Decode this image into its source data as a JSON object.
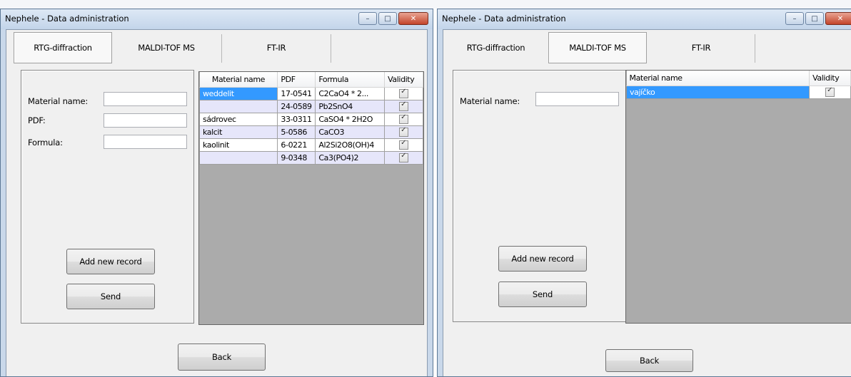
{
  "window1": {
    "title": "Nephele - Data administration",
    "controls": {
      "minimize": "–",
      "maximize": "□",
      "close": "✕"
    },
    "tabs": [
      {
        "label": "RTG-diffraction",
        "active": true
      },
      {
        "label": "MALDI-TOF MS",
        "active": false
      },
      {
        "label": "FT-IR",
        "active": false
      }
    ],
    "form": {
      "fields": [
        {
          "label": "Material name:",
          "value": ""
        },
        {
          "label": "PDF:",
          "value": ""
        },
        {
          "label": "Formula:",
          "value": ""
        }
      ],
      "add_label": "Add new record",
      "send_label": "Send"
    },
    "grid": {
      "columns": [
        "Material name",
        "PDF",
        "Formula",
        "Validity"
      ],
      "rows": [
        {
          "material": "weddelit",
          "pdf": "17-0541",
          "formula": "C2CaO4 * 2...",
          "valid": true,
          "selected": true
        },
        {
          "material": "",
          "pdf": "24-0589",
          "formula": "Pb2SnO4",
          "valid": true
        },
        {
          "material": "sádrovec",
          "pdf": "33-0311",
          "formula": "CaSO4 * 2H2O",
          "valid": true
        },
        {
          "material": "kalcit",
          "pdf": "5-0586",
          "formula": "CaCO3",
          "valid": true
        },
        {
          "material": "kaolinit",
          "pdf": "6-0221",
          "formula": "Al2Si2O8(OH)4",
          "valid": true
        },
        {
          "material": "",
          "pdf": "9-0348",
          "formula": "Ca3(PO4)2",
          "valid": true
        }
      ]
    },
    "back_label": "Back"
  },
  "window2": {
    "title": "Nephele - Data administration",
    "controls": {
      "minimize": "–",
      "maximize": "□",
      "close": "✕"
    },
    "tabs": [
      {
        "label": "RTG-diffraction",
        "active": false
      },
      {
        "label": "MALDI-TOF MS",
        "active": true
      },
      {
        "label": "FT-IR",
        "active": false
      }
    ],
    "form": {
      "fields": [
        {
          "label": "Material name:",
          "value": ""
        }
      ],
      "add_label": "Add new record",
      "send_label": "Send"
    },
    "grid": {
      "columns": [
        "Material name",
        "Validity"
      ],
      "rows": [
        {
          "material": "vajíčko",
          "valid": true,
          "selected": true
        }
      ]
    },
    "back_label": "Back"
  },
  "colors": {
    "title_bg": "#c9d8ea",
    "selection": "#3399ff",
    "grid_bg": "#ababab",
    "alt_row": "#e6e6fa"
  }
}
